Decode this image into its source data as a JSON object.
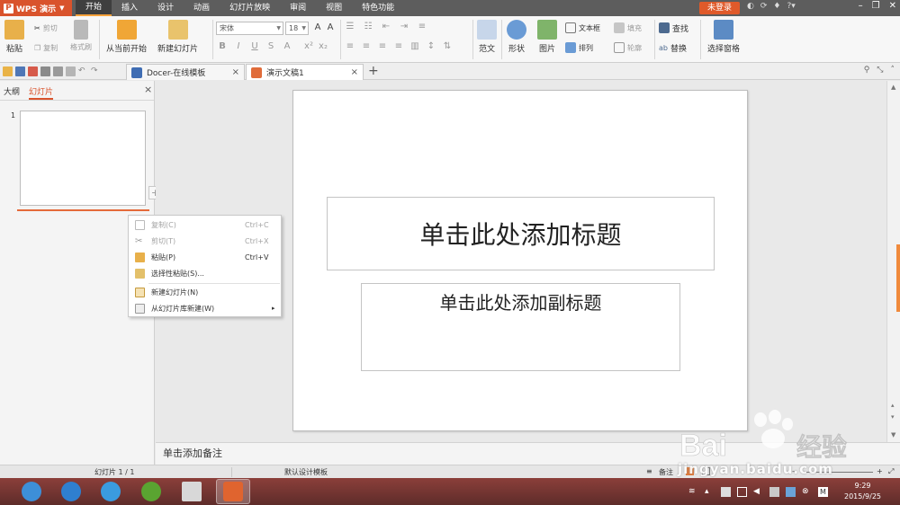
{
  "titlebar": {
    "app_name": "WPS 演示",
    "app_logo": "P",
    "menu_tabs": [
      "开始",
      "插入",
      "设计",
      "动画",
      "幻灯片放映",
      "审阅",
      "视图",
      "特色功能"
    ],
    "active_tab": "开始",
    "login_label": "未登录",
    "accent_color": "#d9532c"
  },
  "ribbon": {
    "paste_label": "粘贴",
    "cut_label": "剪切",
    "copy_label": "复制",
    "format_painter_label": "格式刷",
    "from_current_label": "从当前开始",
    "new_slide_label": "新建幻灯片",
    "font_name": "宋体",
    "font_size": "18",
    "textbox_label": "文本框",
    "fill_label": "填充",
    "find_label": "查找",
    "replace_label": "替换",
    "select_pane_label": "选择窗格",
    "template_label": "范文",
    "shape_label": "形状",
    "picture_label": "图片",
    "arrange_label": "排列",
    "outline_label": "轮廓"
  },
  "tabs": {
    "docer_tab": "Docer-在线模板",
    "doc_tab": "演示文稿1"
  },
  "leftpanel": {
    "outline_tab": "大纲",
    "slides_tab": "幻灯片",
    "slide_number": "1"
  },
  "context_menu": {
    "items": [
      {
        "label": "复制(C)",
        "shortcut": "Ctrl+C",
        "disabled": true
      },
      {
        "label": "剪切(T)",
        "shortcut": "Ctrl+X",
        "disabled": true
      },
      {
        "label": "粘贴(P)",
        "shortcut": "Ctrl+V",
        "disabled": false
      },
      {
        "label": "选择性粘贴(S)...",
        "shortcut": "",
        "disabled": false
      },
      {
        "label": "新建幻灯片(N)",
        "shortcut": "",
        "disabled": false
      },
      {
        "label": "从幻灯片库新建(W)",
        "shortcut": "",
        "disabled": false
      }
    ]
  },
  "slide": {
    "title_placeholder": "单击此处添加标题",
    "subtitle_placeholder": "单击此处添加副标题"
  },
  "notes": {
    "placeholder": "单击添加备注"
  },
  "status": {
    "slide_info": "幻灯片 1 / 1",
    "template": "默认设计模板",
    "notes_label": "备注"
  },
  "taskbar": {
    "time": "9:29",
    "date": "2015/9/25"
  },
  "watermark": {
    "text": "jingyan.baidu.com",
    "logo_text": "Bai 经验"
  }
}
